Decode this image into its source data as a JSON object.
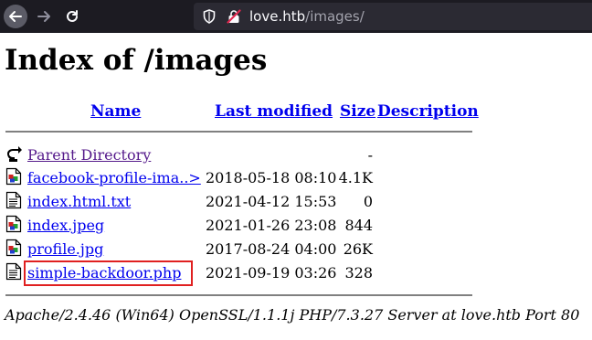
{
  "browser": {
    "url_host": "love.htb",
    "url_path": "/images/",
    "icons": {
      "back": "back-arrow-icon",
      "forward": "forward-arrow-icon",
      "reload": "reload-icon",
      "shield": "shield-icon",
      "insecure": "insecure-lock-icon"
    }
  },
  "page": {
    "title": "Index of /images",
    "columns": {
      "name": "Name",
      "last_modified": "Last modified",
      "size": "Size",
      "description": "Description"
    },
    "rows": [
      {
        "name": "Parent Directory",
        "date": "",
        "size": "-",
        "icon": "back-folder-icon",
        "visited": true
      },
      {
        "name": "facebook-profile-ima..>",
        "date": "2018-05-18 08:10",
        "size": "4.1K",
        "icon": "image-file-icon",
        "visited": false
      },
      {
        "name": "index.html.txt",
        "date": "2021-04-12 15:53",
        "size": "0",
        "icon": "text-file-icon",
        "visited": false
      },
      {
        "name": "index.jpeg",
        "date": "2021-01-26 23:08",
        "size": "844",
        "icon": "image-file-icon",
        "visited": false
      },
      {
        "name": "profile.jpg",
        "date": "2017-08-24 04:00",
        "size": "26K",
        "icon": "image-file-icon",
        "visited": false
      },
      {
        "name": "simple-backdoor.php",
        "date": "2021-09-19 03:26",
        "size": "328",
        "icon": "text-file-icon",
        "visited": false
      }
    ],
    "footer": "Apache/2.4.46 (Win64) OpenSSL/1.1.1j PHP/7.3.27 Server at love.htb Port 80"
  },
  "colors": {
    "toolbar": "#1c1b22",
    "urlbar": "#2b2a33",
    "link": "#0000ee",
    "visited": "#551a8b",
    "highlight": "#e02020"
  }
}
